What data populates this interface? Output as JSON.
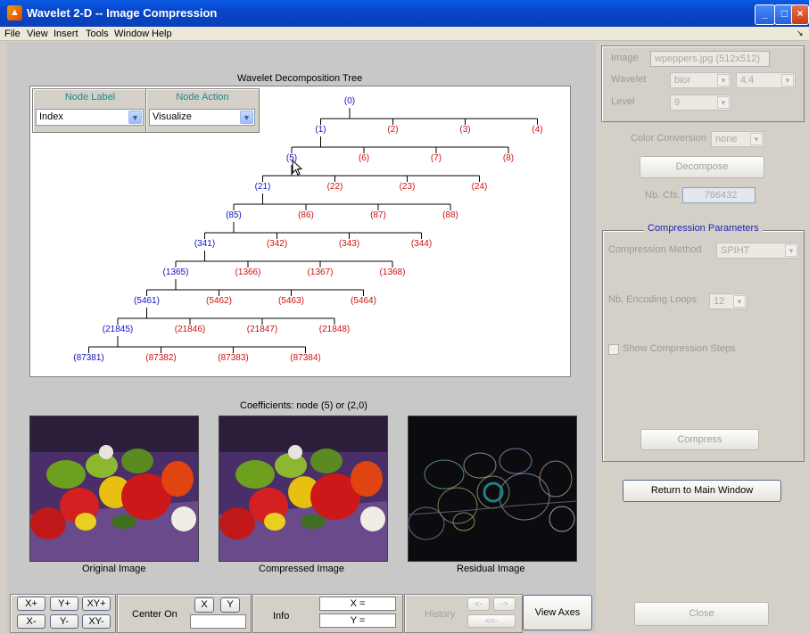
{
  "window": {
    "title": "Wavelet 2-D -- Image Compression",
    "logo_icon": "matlab-logo-icon"
  },
  "menu": [
    "File",
    "View",
    "Insert",
    "Tools",
    "Window",
    "Help"
  ],
  "tree": {
    "caption": "Wavelet Decomposition Tree",
    "node_label": {
      "title": "Node Label",
      "value": "Index"
    },
    "node_action": {
      "title": "Node Action",
      "value": "Visualize"
    },
    "nodes": [
      {
        "label": "(0)",
        "color": "blue"
      },
      {
        "label": "(1)",
        "color": "blue"
      },
      {
        "label": "(2)",
        "color": "red"
      },
      {
        "label": "(3)",
        "color": "red"
      },
      {
        "label": "(4)",
        "color": "red"
      },
      {
        "label": "(5)",
        "color": "blue"
      },
      {
        "label": "(6)",
        "color": "red"
      },
      {
        "label": "(7)",
        "color": "red"
      },
      {
        "label": "(8)",
        "color": "red"
      },
      {
        "label": "(21)",
        "color": "blue"
      },
      {
        "label": "(22)",
        "color": "red"
      },
      {
        "label": "(23)",
        "color": "red"
      },
      {
        "label": "(24)",
        "color": "red"
      },
      {
        "label": "(85)",
        "color": "blue"
      },
      {
        "label": "(86)",
        "color": "red"
      },
      {
        "label": "(87)",
        "color": "red"
      },
      {
        "label": "(88)",
        "color": "red"
      },
      {
        "label": "(341)",
        "color": "blue"
      },
      {
        "label": "(342)",
        "color": "red"
      },
      {
        "label": "(343)",
        "color": "red"
      },
      {
        "label": "(344)",
        "color": "red"
      },
      {
        "label": "(1365)",
        "color": "blue"
      },
      {
        "label": "(1366)",
        "color": "red"
      },
      {
        "label": "(1367)",
        "color": "red"
      },
      {
        "label": "(1368)",
        "color": "red"
      },
      {
        "label": "(5461)",
        "color": "blue"
      },
      {
        "label": "(5462)",
        "color": "red"
      },
      {
        "label": "(5463)",
        "color": "red"
      },
      {
        "label": "(5464)",
        "color": "red"
      },
      {
        "label": "(21845)",
        "color": "blue"
      },
      {
        "label": "(21846)",
        "color": "red"
      },
      {
        "label": "(21847)",
        "color": "red"
      },
      {
        "label": "(21848)",
        "color": "red"
      },
      {
        "label": "(87381)",
        "color": "blue"
      },
      {
        "label": "(87382)",
        "color": "red"
      },
      {
        "label": "(87383)",
        "color": "red"
      },
      {
        "label": "(87384)",
        "color": "red"
      }
    ]
  },
  "coefficients_caption": "Coefficients: node (5) or (2,0)",
  "images": {
    "original": "Original Image",
    "compressed": "Compressed Image",
    "residual": "Residual Image"
  },
  "bottom": {
    "zoom": [
      "X+",
      "Y+",
      "XY+",
      "X-",
      "Y-",
      "XY-"
    ],
    "center_on": "Center On",
    "center_x": "X",
    "center_y": "Y",
    "info": "Info",
    "x_readout": "X =",
    "y_readout": "Y =",
    "history": "History",
    "hist_back": "<-",
    "hist_fwd": "->",
    "hist_first": "<<-",
    "view_axes": "View Axes"
  },
  "right": {
    "image_label": "Image",
    "image_value": "wpeppers.jpg  (512x512)",
    "wavelet_label": "Wavelet",
    "wavelet_family": "bior",
    "wavelet_num": "4.4",
    "level_label": "Level",
    "level_value": "9",
    "color_conversion_label": "Color Conversion",
    "color_conversion_value": "none",
    "decompose": "Decompose",
    "nbcfs_label": "Nb. Cfs.",
    "nbcfs_value": "786432",
    "compression_params_title": "Compression Parameters",
    "method_label": "Compression Method",
    "method_value": "SPIHT",
    "loops_label": "Nb. Encoding Loops",
    "loops_value": "12",
    "show_steps": "Show Compression Steps",
    "compress": "Compress",
    "return_main": "Return to Main Window",
    "close": "Close"
  }
}
